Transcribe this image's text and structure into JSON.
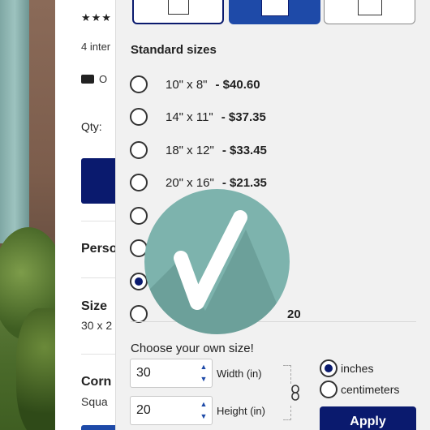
{
  "product": {
    "stars": "★★★",
    "reviews": "4 inter",
    "shipping": "O",
    "qty_label": "Qty:",
    "personalize": "Perso",
    "size_heading": "Size",
    "size_value": "30 x 2",
    "corners_heading": "Corn",
    "corners_value": "Squa"
  },
  "panel": {
    "standard_title": "Standard sizes",
    "options": [
      {
        "size": "10\" x 8\"",
        "price": "- $40.60",
        "checked": false
      },
      {
        "size": "14\" x 11\"",
        "price": "- $37.35",
        "checked": false
      },
      {
        "size": "18\" x 12\"",
        "price": "- $33.45",
        "checked": false
      },
      {
        "size": "20\" x 16\"",
        "price": "- $21.35",
        "checked": false
      },
      {
        "size": "",
        "price": "",
        "checked": false
      },
      {
        "size": "",
        "price": "",
        "checked": false
      },
      {
        "size": "",
        "price": "",
        "checked": true
      },
      {
        "size": "",
        "price": "20",
        "checked": false
      }
    ],
    "own_size_title": "Choose your own size!",
    "width": {
      "value": "30",
      "label": "Width (in)"
    },
    "height": {
      "value": "20",
      "label": "Height (in)"
    },
    "units": [
      {
        "label": "inches",
        "checked": true
      },
      {
        "label": "centimeters",
        "checked": false
      }
    ],
    "apply_label": "Apply"
  },
  "icons": {
    "truck": "truck-icon",
    "link": "link-icon",
    "badge": "checkmark-arrow-icon"
  },
  "colors": {
    "navy": "#0a1a6e",
    "blue": "#1e4aa8",
    "badge": "#7db3ad",
    "panel_bg": "#f1f1f1"
  }
}
